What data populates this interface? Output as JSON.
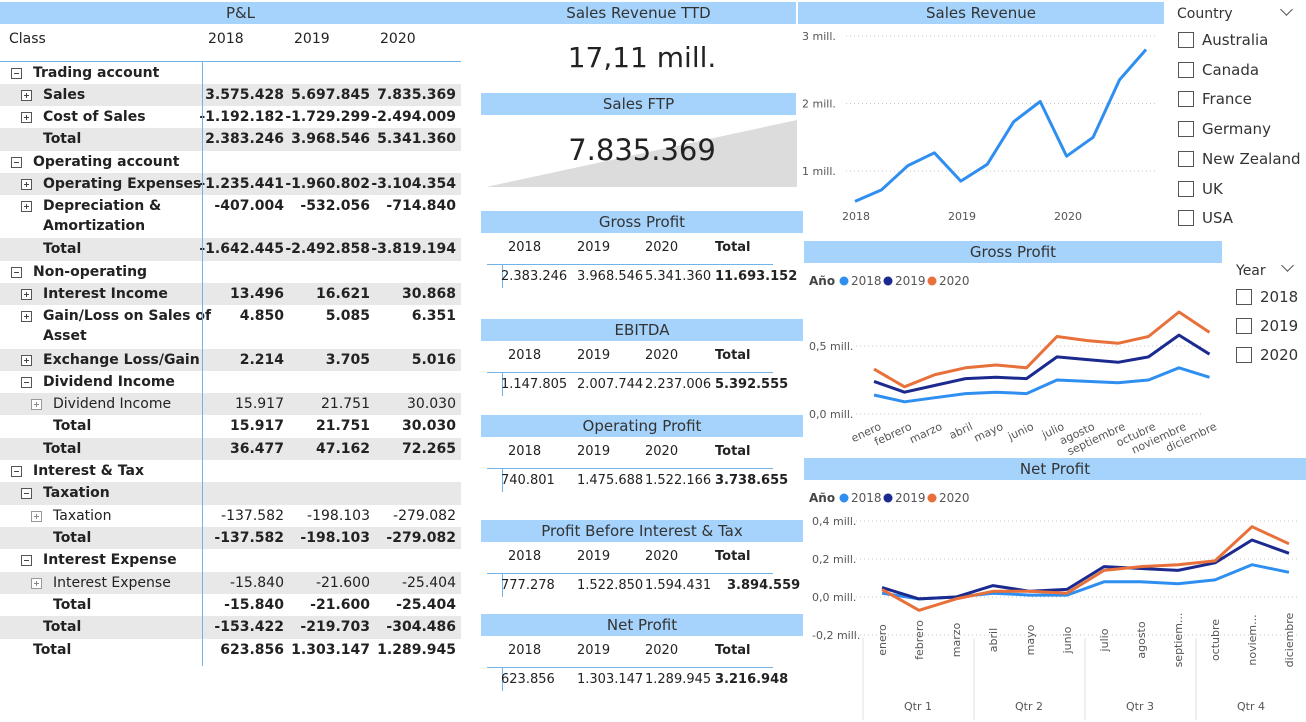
{
  "pl": {
    "title": "P&L",
    "headers": [
      "Class",
      "2018",
      "2019",
      "2020"
    ],
    "rows": [
      {
        "label": "Trading account",
        "indent": 0,
        "icon": "minus",
        "bold": true,
        "shade": false,
        "h": 22,
        "v": [
          "",
          "",
          ""
        ]
      },
      {
        "label": "Sales",
        "indent": 1,
        "icon": "plus",
        "bold": true,
        "shade": true,
        "h": 22,
        "v": [
          "3.575.428",
          "5.697.845",
          "7.835.369"
        ]
      },
      {
        "label": "Cost of Sales",
        "indent": 1,
        "icon": "plus",
        "bold": true,
        "shade": false,
        "h": 22,
        "v": [
          "-1.192.182",
          "-1.729.299",
          "-2.494.009"
        ]
      },
      {
        "label": "Total",
        "indent": 1,
        "icon": "",
        "bold": true,
        "shade": true,
        "h": 23,
        "v": [
          "2.383.246",
          "3.968.546",
          "5.341.360"
        ]
      },
      {
        "label": "Operating account",
        "indent": 0,
        "icon": "minus",
        "bold": true,
        "shade": false,
        "h": 22,
        "v": [
          "",
          "",
          ""
        ]
      },
      {
        "label": "Operating Expenses",
        "indent": 1,
        "icon": "plus",
        "bold": true,
        "shade": true,
        "h": 22,
        "v": [
          "-1.235.441",
          "-1.960.802",
          "-3.104.354"
        ]
      },
      {
        "label": "Depreciation &",
        "label2": "Amortization",
        "indent": 1,
        "icon": "plus",
        "bold": true,
        "shade": false,
        "h": 43,
        "v": [
          "-407.004",
          "-532.056",
          "-714.840"
        ]
      },
      {
        "label": "Total",
        "indent": 1,
        "icon": "",
        "bold": true,
        "shade": true,
        "h": 23,
        "v": [
          "-1.642.445",
          "-2.492.858",
          "-3.819.194"
        ]
      },
      {
        "label": "Non-operating",
        "indent": 0,
        "icon": "minus",
        "bold": true,
        "shade": false,
        "h": 22,
        "v": [
          "",
          "",
          ""
        ]
      },
      {
        "label": "Interest Income",
        "indent": 1,
        "icon": "plus",
        "bold": true,
        "shade": true,
        "h": 22,
        "v": [
          "13.496",
          "16.621",
          "30.868"
        ]
      },
      {
        "label": "Gain/Loss on Sales of",
        "label2": "Asset",
        "indent": 1,
        "icon": "plus",
        "bold": true,
        "shade": false,
        "h": 44,
        "v": [
          "4.850",
          "5.085",
          "6.351"
        ]
      },
      {
        "label": "Exchange Loss/Gain",
        "indent": 1,
        "icon": "plus",
        "bold": true,
        "shade": true,
        "h": 22,
        "v": [
          "2.214",
          "3.705",
          "5.016"
        ]
      },
      {
        "label": "Dividend Income",
        "indent": 1,
        "icon": "minus",
        "bold": true,
        "shade": false,
        "h": 22,
        "v": [
          "",
          "",
          ""
        ]
      },
      {
        "label": "Dividend Income",
        "indent": 2,
        "icon": "plus-lite",
        "bold": false,
        "shade": true,
        "h": 22,
        "v": [
          "15.917",
          "21.751",
          "30.030"
        ]
      },
      {
        "label": "Total",
        "indent": 2,
        "icon": "",
        "bold": true,
        "shade": false,
        "h": 23,
        "v": [
          "15.917",
          "21.751",
          "30.030"
        ]
      },
      {
        "label": "Total",
        "indent": 1,
        "icon": "",
        "bold": true,
        "shade": true,
        "h": 22,
        "v": [
          "36.477",
          "47.162",
          "72.265"
        ]
      },
      {
        "label": "Interest & Tax",
        "indent": 0,
        "icon": "minus",
        "bold": true,
        "shade": false,
        "h": 22,
        "v": [
          "",
          "",
          ""
        ]
      },
      {
        "label": "Taxation",
        "indent": 1,
        "icon": "minus",
        "bold": true,
        "shade": true,
        "h": 23,
        "v": [
          "",
          "",
          ""
        ]
      },
      {
        "label": "Taxation",
        "indent": 2,
        "icon": "plus-lite",
        "bold": false,
        "shade": false,
        "h": 22,
        "v": [
          "-137.582",
          "-198.103",
          "-279.082"
        ]
      },
      {
        "label": "Total",
        "indent": 2,
        "icon": "",
        "bold": true,
        "shade": true,
        "h": 22,
        "v": [
          "-137.582",
          "-198.103",
          "-279.082"
        ]
      },
      {
        "label": "Interest Expense",
        "indent": 1,
        "icon": "minus",
        "bold": true,
        "shade": false,
        "h": 23,
        "v": [
          "",
          "",
          ""
        ]
      },
      {
        "label": "Interest Expense",
        "indent": 2,
        "icon": "plus-lite",
        "bold": false,
        "shade": true,
        "h": 22,
        "v": [
          "-15.840",
          "-21.600",
          "-25.404"
        ]
      },
      {
        "label": "Total",
        "indent": 2,
        "icon": "",
        "bold": true,
        "shade": false,
        "h": 22,
        "v": [
          "-15.840",
          "-21.600",
          "-25.404"
        ]
      },
      {
        "label": "Total",
        "indent": 1,
        "icon": "",
        "bold": true,
        "shade": true,
        "h": 23,
        "v": [
          "-153.422",
          "-219.703",
          "-304.486"
        ]
      },
      {
        "label": "Total",
        "indent": 0,
        "icon": "",
        "bold": true,
        "shade": false,
        "h": 22,
        "v": [
          "623.856",
          "1.303.147",
          "1.289.945"
        ]
      }
    ]
  },
  "cards": {
    "sales_ttd_title": "Sales Revenue TTD",
    "sales_ttd_value": "17,11 mill.",
    "sales_ftp_title": "Sales FTP",
    "sales_ftp_value": "7.835.369"
  },
  "mini_tables": [
    {
      "title": "Gross Profit",
      "headers": [
        "2018",
        "2019",
        "2020",
        "Total"
      ],
      "values": [
        "2.383.246",
        "3.968.546",
        "5.341.360",
        "11.693.152"
      ]
    },
    {
      "title": "EBITDA",
      "headers": [
        "2018",
        "2019",
        "2020",
        "Total"
      ],
      "values": [
        "1.147.805",
        "2.007.744",
        "2.237.006",
        "5.392.555"
      ]
    },
    {
      "title": "Operating Profit",
      "headers": [
        "2018",
        "2019",
        "2020",
        "Total"
      ],
      "values": [
        "740.801",
        "1.475.688",
        "1.522.166",
        "3.738.655"
      ]
    },
    {
      "title": "Profit Before Interest & Tax",
      "headers": [
        "2018",
        "2019",
        "2020",
        "Total"
      ],
      "values": [
        "777.278",
        "1.522.850",
        "1.594.431",
        "3.894.559"
      ]
    },
    {
      "title": "Net Profit",
      "headers": [
        "2018",
        "2019",
        "2020",
        "Total"
      ],
      "values": [
        "623.856",
        "1.303.147",
        "1.289.945",
        "3.216.948"
      ]
    }
  ],
  "slicers": {
    "country_title": "Country",
    "countries": [
      "Australia",
      "Canada",
      "France",
      "Germany",
      "New Zealand",
      "UK",
      "USA"
    ],
    "year_title": "Year",
    "years": [
      "2018",
      "2019",
      "2020"
    ]
  },
  "colors": {
    "accent": "#a5d3fb",
    "s2018": "#2f8ff0",
    "s2019": "#1b2a8f",
    "s2020": "#e8703a",
    "line": "#2f8ff0"
  },
  "chart_data": [
    {
      "type": "line",
      "title": "Sales Revenue",
      "x": [
        "2018-Q1",
        "2018-Q2",
        "2018-Q3",
        "2018-Q4",
        "2019-Q1",
        "2019-Q2",
        "2019-Q3",
        "2019-Q4",
        "2020-Q1",
        "2020-Q2",
        "2020-Q3",
        "2020-Q4"
      ],
      "xticks": [
        "2018",
        "2019",
        "2020"
      ],
      "yticks": [
        "1 mill.",
        "2 mill.",
        "3 mill."
      ],
      "values": [
        0.55,
        0.72,
        1.08,
        1.27,
        0.85,
        1.1,
        1.73,
        2.03,
        1.22,
        1.5,
        2.35,
        2.8
      ],
      "ylim": [
        0.5,
        3.0
      ],
      "unit": "mill.",
      "grid": true
    },
    {
      "type": "line",
      "title": "Gross Profit",
      "legend_title": "Año",
      "legend_position": "top-left",
      "categories": [
        "enero",
        "febrero",
        "marzo",
        "abril",
        "mayo",
        "junio",
        "julio",
        "agosto",
        "septiembre",
        "octubre",
        "noviembre",
        "diciembre"
      ],
      "yticks": [
        "0,0 mill.",
        "0,5 mill."
      ],
      "ylim": [
        0,
        0.75
      ],
      "series": [
        {
          "name": "2018",
          "values": [
            0.14,
            0.09,
            0.12,
            0.15,
            0.16,
            0.15,
            0.25,
            0.24,
            0.23,
            0.25,
            0.34,
            0.27
          ]
        },
        {
          "name": "2019",
          "values": [
            0.24,
            0.16,
            0.21,
            0.26,
            0.27,
            0.26,
            0.42,
            0.4,
            0.38,
            0.42,
            0.58,
            0.44
          ]
        },
        {
          "name": "2020",
          "values": [
            0.33,
            0.2,
            0.29,
            0.34,
            0.36,
            0.34,
            0.57,
            0.54,
            0.52,
            0.57,
            0.75,
            0.6
          ]
        }
      ],
      "grid": true
    },
    {
      "type": "line",
      "title": "Net Profit",
      "legend_title": "Año",
      "legend_position": "top-left",
      "categories": [
        "enero",
        "febrero",
        "marzo",
        "abril",
        "mayo",
        "junio",
        "julio",
        "agosto",
        "septiem...",
        "octubre",
        "noviem...",
        "diciembre"
      ],
      "groups": [
        "Qtr 1",
        "Qtr 2",
        "Qtr 3",
        "Qtr 4"
      ],
      "yticks": [
        "-0,2 mill.",
        "0,0 mill.",
        "0,2 mill.",
        "0,4 mill."
      ],
      "ylim": [
        -0.2,
        0.4
      ],
      "series": [
        {
          "name": "2018",
          "values": [
            0.02,
            -0.01,
            0.0,
            0.02,
            0.01,
            0.01,
            0.08,
            0.08,
            0.07,
            0.09,
            0.17,
            0.13
          ]
        },
        {
          "name": "2019",
          "values": [
            0.05,
            -0.01,
            0.0,
            0.06,
            0.03,
            0.04,
            0.16,
            0.15,
            0.14,
            0.18,
            0.3,
            0.23
          ]
        },
        {
          "name": "2020",
          "values": [
            0.04,
            -0.07,
            -0.01,
            0.03,
            0.03,
            0.02,
            0.14,
            0.16,
            0.17,
            0.19,
            0.37,
            0.28
          ]
        }
      ],
      "grid": true
    }
  ]
}
